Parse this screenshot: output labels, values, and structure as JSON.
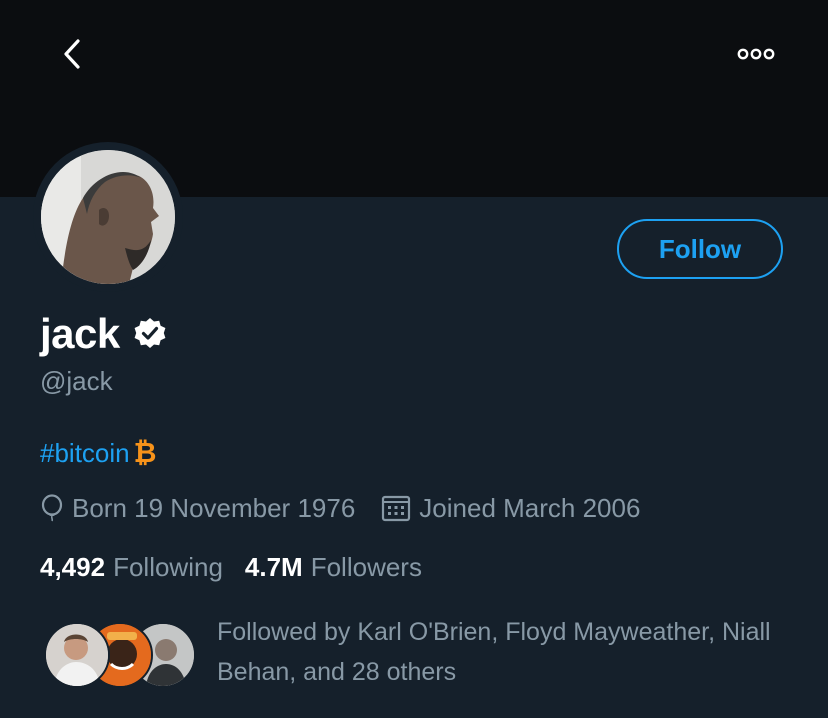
{
  "header": {
    "back_icon": "chevron-left-icon",
    "more_icon": "more-options-icon"
  },
  "profile": {
    "display_name": "jack",
    "verified_icon": "verified-badge-icon",
    "handle": "@jack",
    "bio_hashtag": "#bitcoin",
    "bio_symbol": "₿",
    "follow_label": "Follow"
  },
  "meta": {
    "born": "Born 19 November 1976",
    "joined": "Joined March 2006"
  },
  "stats": {
    "following_count": "4,492",
    "following_label": "Following",
    "followers_count": "4.7M",
    "followers_label": "Followers"
  },
  "followed_by": {
    "text": "Followed by Karl O'Brien, Floyd Mayweather, Niall Behan, and 28 others"
  },
  "colors": {
    "background": "#15202b",
    "banner": "#0b0d10",
    "accent": "#1da1f2",
    "secondary_text": "#8899a6",
    "bitcoin_orange": "#f7931a"
  }
}
